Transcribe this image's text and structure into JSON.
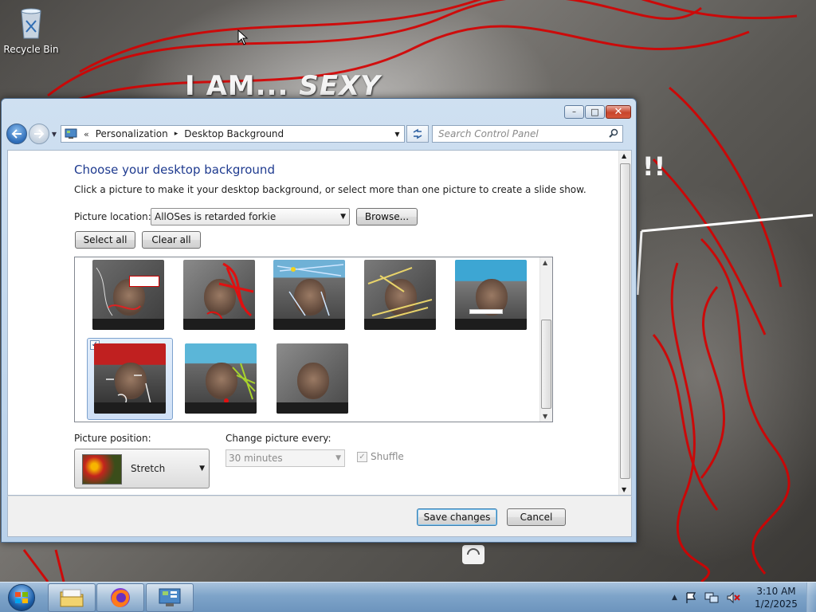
{
  "desktop": {
    "recycle_bin_label": "Recycle Bin",
    "wallpaper_text_1": "I AM...",
    "wallpaper_text_2": "SEXY",
    "wallpaper_text_3": "!!"
  },
  "window": {
    "caption_buttons": {
      "minimize": "–",
      "maximize": "□",
      "close": "✕"
    },
    "breadcrumb": {
      "sep": "«",
      "item1": "Personalization",
      "arrow": "▸",
      "item2": "Desktop Background"
    },
    "search_placeholder": "Search Control Panel",
    "heading": "Choose your desktop background",
    "description": "Click a picture to make it your desktop background, or select more than one picture to create a slide show.",
    "picture_location_label": "Picture location:",
    "picture_location_value": "AllOSes is retarded forkie",
    "browse_label": "Browse...",
    "select_all_label": "Select all",
    "clear_all_label": "Clear all",
    "picture_position_label": "Picture position:",
    "picture_position_value": "Stretch",
    "change_every_label": "Change picture every:",
    "change_every_value": "30 minutes",
    "shuffle_label": "Shuffle",
    "shuffle_checked": true,
    "save_label": "Save changes",
    "cancel_label": "Cancel"
  },
  "gallery": {
    "selected_index": 5,
    "count": 8
  },
  "taskbar": {
    "time": "3:10 AM",
    "date": "1/2/2025"
  },
  "colors": {
    "heading": "#1e3a8f",
    "scribble": "#d60000",
    "taskbar": "#7ea4c9"
  }
}
